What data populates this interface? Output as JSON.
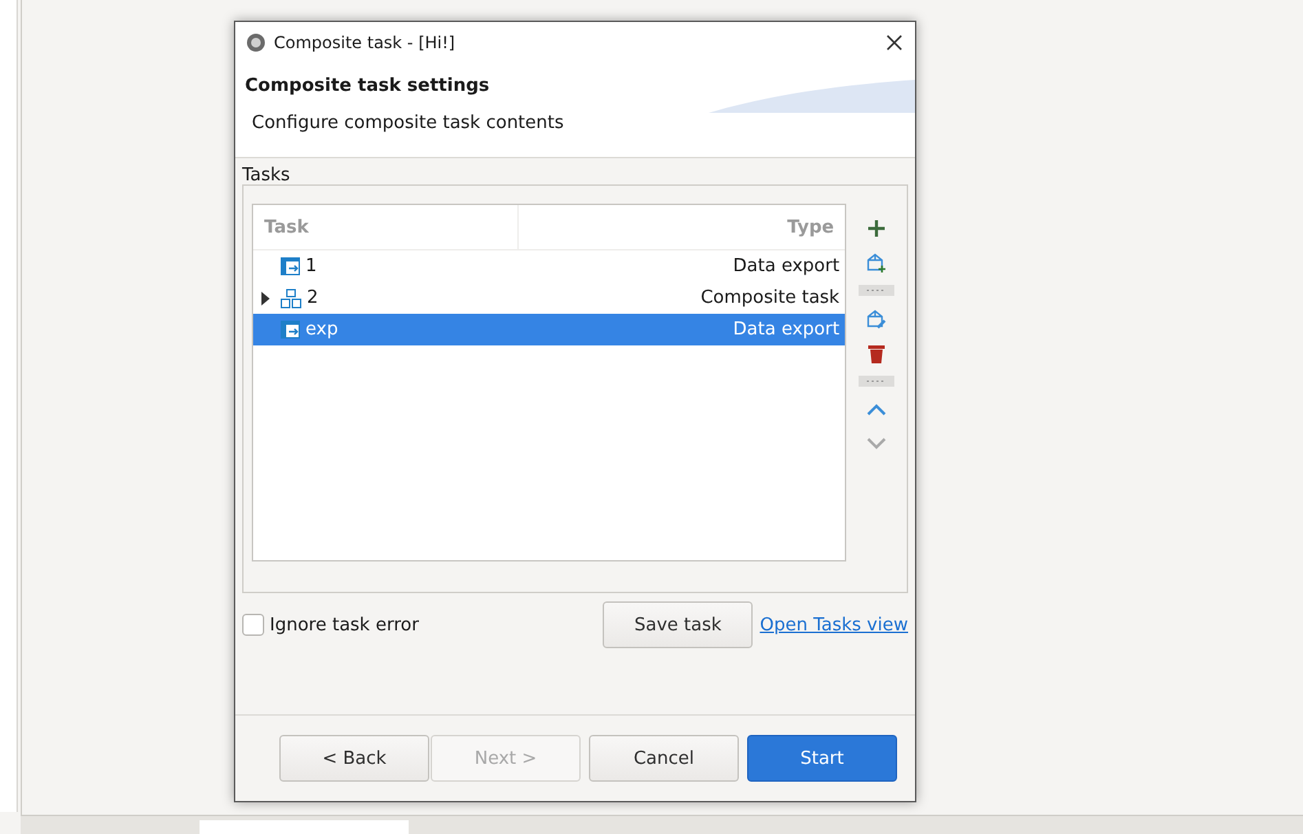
{
  "window": {
    "title": "Composite task - [Hi!]"
  },
  "header": {
    "title": "Composite task settings",
    "subtitle": "Configure composite task contents"
  },
  "tasks_group": {
    "label": "Tasks"
  },
  "table": {
    "columns": [
      "Task",
      "Type"
    ],
    "rows": [
      {
        "kind": "export",
        "name": "1",
        "type": "Data export",
        "selected": false
      },
      {
        "kind": "composite",
        "name": "2",
        "type": "Composite task",
        "selected": false,
        "expanded": false
      },
      {
        "kind": "export",
        "name": "exp",
        "type": "Data export",
        "selected": true
      }
    ]
  },
  "toolbar": [
    {
      "kind": "add",
      "disabled": false
    },
    {
      "kind": "add-copy",
      "disabled": false
    },
    {
      "kind": "separator"
    },
    {
      "kind": "edit",
      "disabled": false
    },
    {
      "kind": "delete",
      "disabled": false
    },
    {
      "kind": "separator"
    },
    {
      "kind": "up",
      "disabled": false
    },
    {
      "kind": "down",
      "disabled": true
    }
  ],
  "ignore_error": {
    "label": "Ignore task error",
    "checked": false
  },
  "save_button": "Save task",
  "link": "Open Tasks view",
  "buttons": [
    {
      "label": "< Back",
      "disabled": false,
      "primary": false
    },
    {
      "label": "Next >",
      "disabled": true,
      "primary": false
    },
    {
      "label": "Cancel",
      "disabled": false,
      "primary": false
    },
    {
      "label": "Start",
      "disabled": false,
      "primary": true
    }
  ]
}
